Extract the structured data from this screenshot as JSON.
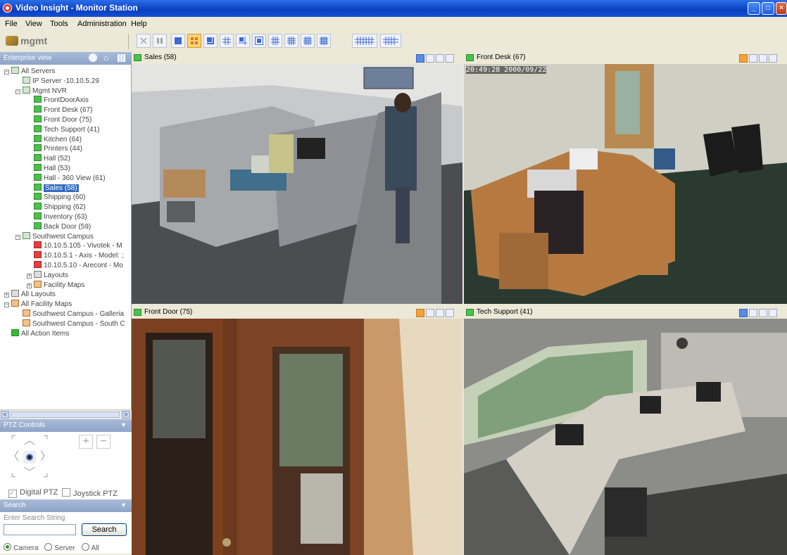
{
  "window": {
    "title": "Video Insight - Monitor Station"
  },
  "menu": [
    "File",
    "View",
    "Tools",
    "Administration",
    "Help"
  ],
  "toolbar": {
    "group_name": "mgmt"
  },
  "enterprise_panel": {
    "title": "Enterprise view"
  },
  "tree": [
    {
      "label": "All Servers",
      "type": "server",
      "level": 0,
      "expanded": true
    },
    {
      "label": "IP Server -10.10.5.29",
      "type": "server",
      "level": 1
    },
    {
      "label": "Mgmt NVR",
      "type": "server",
      "level": 1,
      "expanded": true
    },
    {
      "label": "FrontDoorAxis",
      "type": "camera",
      "level": 2
    },
    {
      "label": "Front Desk (67)",
      "type": "camera",
      "level": 2
    },
    {
      "label": "Front Door (75)",
      "type": "camera",
      "level": 2
    },
    {
      "label": "Tech Support (41)",
      "type": "camera",
      "level": 2
    },
    {
      "label": "Kitchen (64)",
      "type": "camera",
      "level": 2
    },
    {
      "label": "Printers (44)",
      "type": "camera",
      "level": 2
    },
    {
      "label": "Hall (52)",
      "type": "camera",
      "level": 2
    },
    {
      "label": "Hall (53)",
      "type": "camera",
      "level": 2
    },
    {
      "label": "Hall - 360 View (61)",
      "type": "camera",
      "level": 2
    },
    {
      "label": "Sales (58)",
      "type": "camera",
      "level": 2,
      "selected": true
    },
    {
      "label": "Shipping (60)",
      "type": "camera",
      "level": 2
    },
    {
      "label": "Shipping (62)",
      "type": "camera",
      "level": 2
    },
    {
      "label": "Inventory (63)",
      "type": "camera",
      "level": 2
    },
    {
      "label": "Back Door (59)",
      "type": "camera",
      "level": 2
    },
    {
      "label": "Southwest Campus",
      "type": "server",
      "level": 1,
      "expanded": true
    },
    {
      "label": "10.10.5.105 - Vivotek - M",
      "type": "camera-red",
      "level": 2
    },
    {
      "label": "10.10.5.1 - Axis - Model: ;",
      "type": "camera-red",
      "level": 2
    },
    {
      "label": "10.10.5.10 - Arecont - Mo",
      "type": "camera-red",
      "level": 2
    },
    {
      "label": "Layouts",
      "type": "grid",
      "level": 2,
      "expanded": false
    },
    {
      "label": "Facility Maps",
      "type": "map",
      "level": 2,
      "expanded": false
    },
    {
      "label": "All Layouts",
      "type": "grid",
      "level": 0,
      "expanded": false
    },
    {
      "label": "All Facility Maps",
      "type": "map",
      "level": 0,
      "expanded": true
    },
    {
      "label": "Southwest Campus - Galleria",
      "type": "map",
      "level": 1
    },
    {
      "label": "Southwest Campus - South C",
      "type": "map",
      "level": 1
    },
    {
      "label": "All Action Items",
      "type": "action",
      "level": 0
    }
  ],
  "ptz": {
    "title": "PTZ Controls",
    "digital_ptz": "Digital PTZ",
    "joystick_ptz": "Joystick PTZ",
    "digital_checked": true,
    "joystick_checked": false
  },
  "search": {
    "title": "Search",
    "label": "Enter Search String",
    "value": "",
    "button": "Search",
    "options": [
      "Camera",
      "Server",
      "All"
    ],
    "selected": "Camera"
  },
  "cameras": [
    {
      "title": "Sales (58)",
      "timestamp": ""
    },
    {
      "title": "Front Desk (67)",
      "timestamp": "20:49:28 2000/09/22"
    },
    {
      "title": "Front Door (75)",
      "timestamp": ""
    },
    {
      "title": "Tech Support (41)",
      "timestamp": ""
    }
  ]
}
